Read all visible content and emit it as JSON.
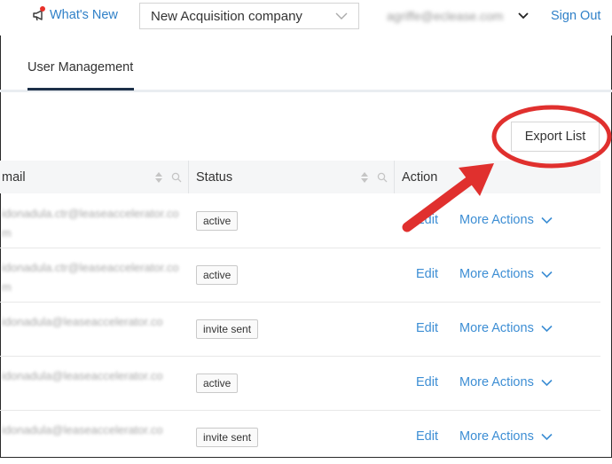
{
  "header": {
    "whats_new_label": "What's New",
    "company_select_value": "New Acquisition company",
    "user_email": "agriffe@eclease.com",
    "sign_out_label": "Sign Out"
  },
  "tabs": [
    {
      "label": "User Management",
      "active": true
    }
  ],
  "toolbar": {
    "export_label": "Export List"
  },
  "table": {
    "columns": [
      "mail",
      "Status",
      "Action"
    ],
    "rows": [
      {
        "email": "idonadula.ctr@leaseaccelerator.com",
        "status": "active",
        "edit": "Edit",
        "more": "More Actions"
      },
      {
        "email": "idonadula.ctr@leaseaccelerator.com",
        "status": "active",
        "edit": "Edit",
        "more": "More Actions"
      },
      {
        "email": "idonadula@leaseaccelerator.co",
        "status": "invite sent",
        "edit": "Edit",
        "more": "More Actions"
      },
      {
        "email": "idonadula@leaseaccelerator.co",
        "status": "active",
        "edit": "Edit",
        "more": "More Actions"
      },
      {
        "email": "idonadula@leaseaccelerator.co",
        "status": "invite sent",
        "edit": "Edit",
        "more": "More Actions"
      }
    ]
  },
  "colors": {
    "link": "#3d8ed4",
    "annotation": "#e0302e",
    "tab_underline": "#1d3048"
  }
}
